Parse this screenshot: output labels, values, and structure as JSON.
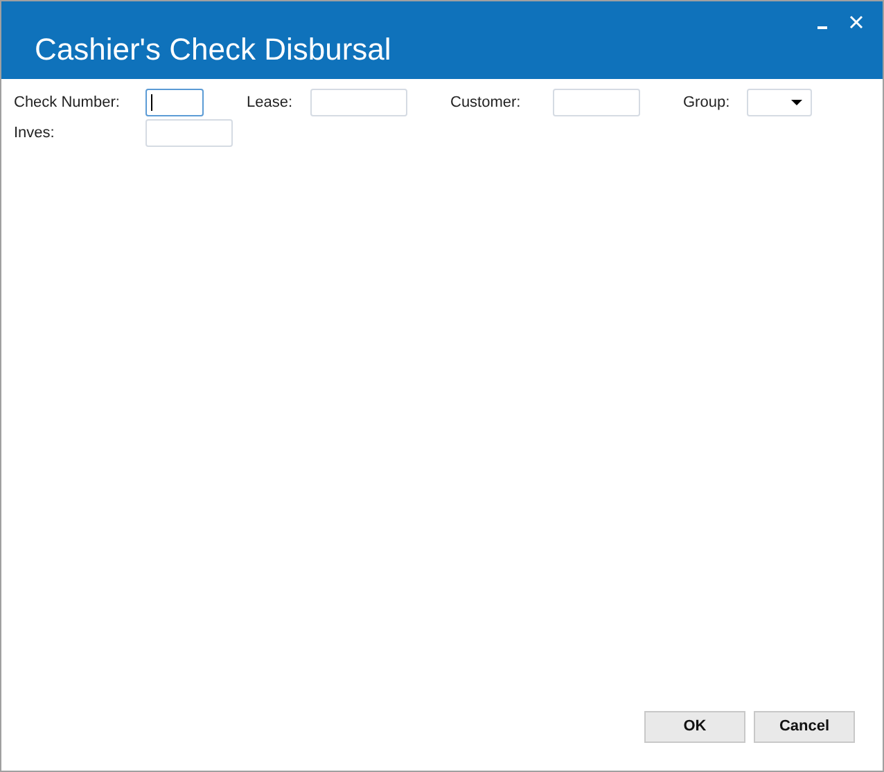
{
  "window": {
    "title": "Cashier's Check Disbursal"
  },
  "fields": [
    {
      "label": "Check Number:",
      "kind": "text",
      "focused": true
    },
    {
      "label": "Lease:",
      "kind": "text",
      "focused": false
    },
    {
      "label": "Customer:",
      "kind": "text",
      "focused": false
    },
    {
      "label": "Group:",
      "kind": "dropdown",
      "focused": false
    },
    {
      "label": "Inves:",
      "kind": "text",
      "focused": false
    }
  ],
  "buttons": [
    "OK",
    "Cancel"
  ]
}
